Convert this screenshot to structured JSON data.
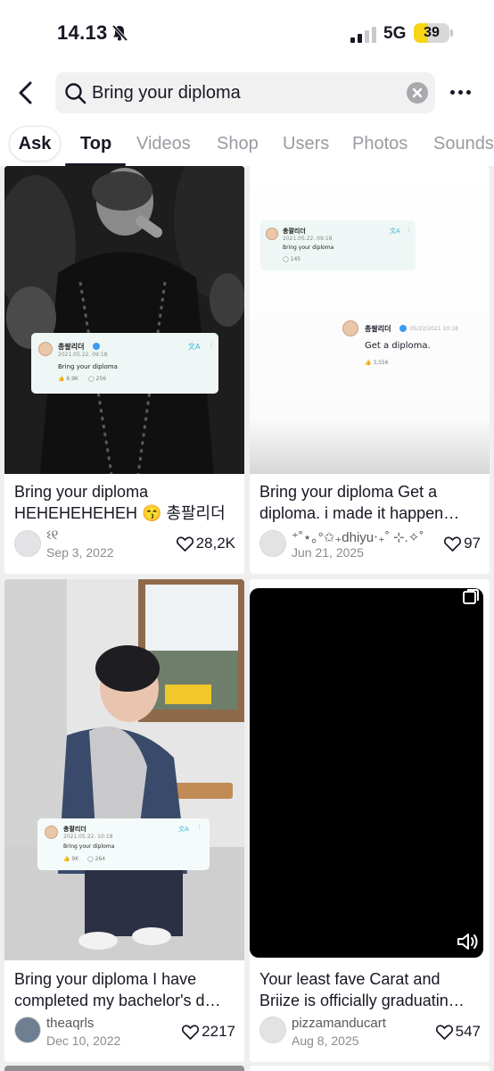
{
  "status_bar": {
    "time": "14.13",
    "network": "5G",
    "battery": "39",
    "battery_level": 0.39
  },
  "search": {
    "query": "Bring your diploma"
  },
  "tabs": [
    {
      "label": "Ask"
    },
    {
      "label": "Top"
    },
    {
      "label": "Videos"
    },
    {
      "label": "Shop"
    },
    {
      "label": "Users"
    },
    {
      "label": "Photos"
    },
    {
      "label": "Sounds"
    }
  ],
  "posts": [
    {
      "caption_line1": "Bring your diploma",
      "caption_line2": "HEHEHEHEHEH 😙 총팔리더",
      "user": "ଽ୧",
      "date": "Sep 3, 2022",
      "likes": "28,2K",
      "tweet": {
        "name": "총팔리더",
        "date": "2021.05.22. 09:18",
        "text": "Bring your diploma",
        "meta1": "6.9K",
        "meta2": "256"
      }
    },
    {
      "caption_line1": "Bring your diploma Get a",
      "caption_line2": "diploma. i made it happen…",
      "user": "⁺˚⋆｡°✩₊dhiyu‧₊˚ ⊹.✧˚",
      "date": "Jun 21, 2025",
      "likes": "97",
      "tweet1": {
        "name": "총팔리더",
        "date": "2021.05.22. 09:18",
        "text": "Bring your diploma",
        "meta": "145"
      },
      "tweet2": {
        "name": "총팔리더",
        "date": "05/22/2021 10:18",
        "text": "Get a diploma.",
        "meta": "3,556"
      }
    },
    {
      "caption_line1": "Bring your diploma I have",
      "caption_line2": "completed my bachelor's d…",
      "user": "theaqrls",
      "date": "Dec 10, 2022",
      "likes": "2217",
      "tweet": {
        "name": "총팔리더",
        "date": "2021.05.22. 10:18",
        "text": "Bring your diploma",
        "meta1": "9K",
        "meta2": "264"
      }
    },
    {
      "caption_line1": "Your least fave Carat and",
      "caption_line2": "Briize is officially graduatin…",
      "user": "pizzamanducart",
      "date": "Aug 8, 2025",
      "likes": "547"
    }
  ]
}
